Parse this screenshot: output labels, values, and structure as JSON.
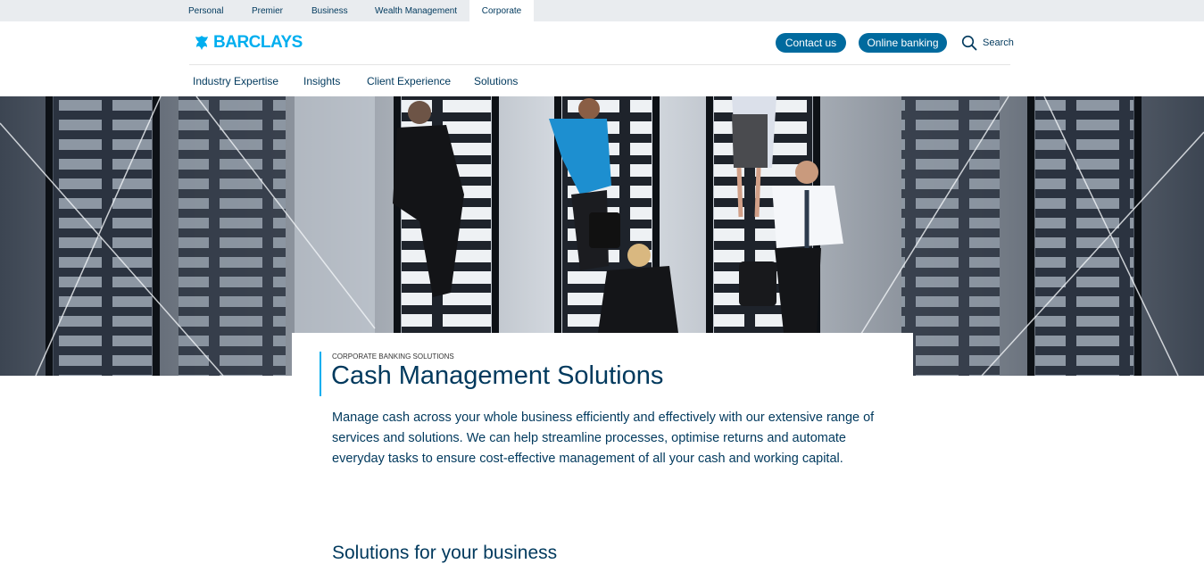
{
  "segments": {
    "items": [
      {
        "label": "Personal"
      },
      {
        "label": "Premier"
      },
      {
        "label": "Business"
      },
      {
        "label": "Wealth Management"
      },
      {
        "label": "Corporate"
      }
    ],
    "active": "Corporate"
  },
  "header": {
    "logo_text": "BARCLAYS",
    "contact_label": "Contact us",
    "online_banking_label": "Online banking",
    "search_label": "Search",
    "accent_color": "#006a9e",
    "brand_color": "#00aeef"
  },
  "nav": {
    "items": [
      {
        "label": "Industry Expertise"
      },
      {
        "label": "Insights"
      },
      {
        "label": "Client Experience"
      },
      {
        "label": "Solutions"
      }
    ]
  },
  "content": {
    "eyebrow": "CORPORATE BANKING SOLUTIONS",
    "title": "Cash Management Solutions",
    "intro": "Manage cash across your whole business efficiently and effectively with our extensive range of services and solutions. We can help streamline processes, optimise returns and automate everyday tasks to ensure cost-effective management of all your cash and working capital.",
    "section_title": "Solutions for your business"
  }
}
